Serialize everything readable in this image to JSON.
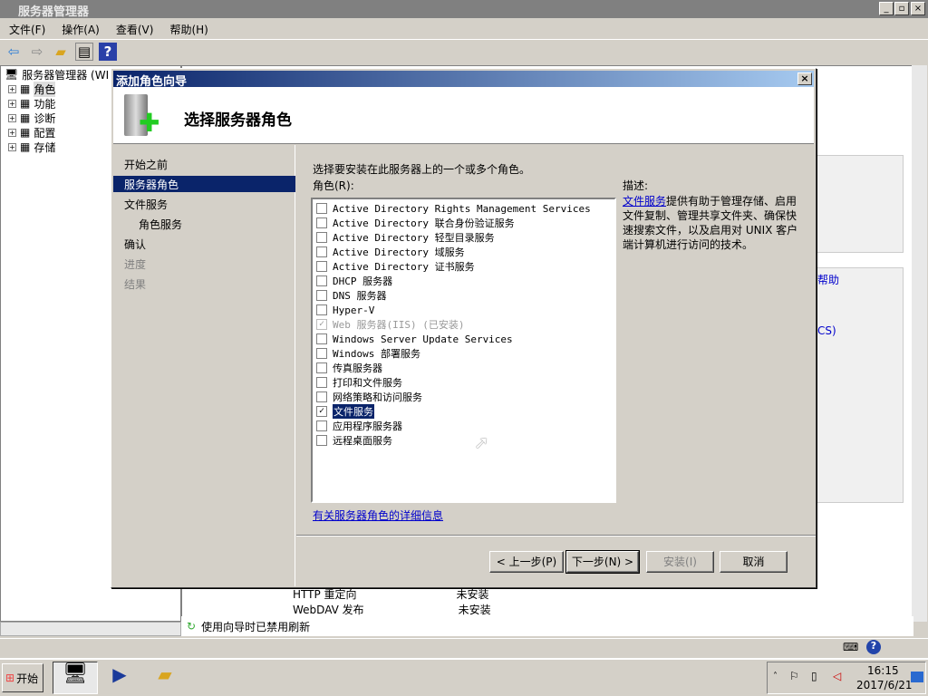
{
  "window": {
    "title": "服务器管理器",
    "min": "_",
    "restore": "▫",
    "close": "×"
  },
  "menu": [
    "文件(F)",
    "操作(A)",
    "查看(V)",
    "帮助(H)"
  ],
  "tree": {
    "root": "服务器管理器 (WI",
    "items": [
      "角色",
      "功能",
      "诊断",
      "配置",
      "存储"
    ]
  },
  "background": {
    "link_fragment": "帮助",
    "link_fragment2": "CS)",
    "rows": [
      {
        "name": "HTTP 重定向",
        "state": "未安装"
      },
      {
        "name": "WebDAV 发布",
        "state": "未安装"
      }
    ],
    "status": "使用向导时已禁用刷新"
  },
  "dialog": {
    "title": "添加角色向导",
    "heading": "选择服务器角色",
    "nav": [
      {
        "label": "开始之前",
        "state": "normal"
      },
      {
        "label": "服务器角色",
        "state": "selected"
      },
      {
        "label": "文件服务",
        "state": "normal"
      },
      {
        "label": "角色服务",
        "state": "sub"
      },
      {
        "label": "确认",
        "state": "normal"
      },
      {
        "label": "进度",
        "state": "disabled"
      },
      {
        "label": "结果",
        "state": "disabled"
      }
    ],
    "instruction": "选择要安装在此服务器上的一个或多个角色。",
    "roles_label": "角色(R):",
    "roles": [
      {
        "label": "Active Directory Rights Management Services",
        "checked": false
      },
      {
        "label": "Active Directory 联合身份验证服务",
        "checked": false
      },
      {
        "label": "Active Directory 轻型目录服务",
        "checked": false
      },
      {
        "label": "Active Directory 域服务",
        "checked": false
      },
      {
        "label": "Active Directory 证书服务",
        "checked": false
      },
      {
        "label": "DHCP 服务器",
        "checked": false
      },
      {
        "label": "DNS 服务器",
        "checked": false
      },
      {
        "label": "Hyper-V",
        "checked": false
      },
      {
        "label": "Web 服务器(IIS)  (已安装)",
        "checked": true,
        "disabled": true
      },
      {
        "label": "Windows Server Update Services",
        "checked": false
      },
      {
        "label": "Windows 部署服务",
        "checked": false
      },
      {
        "label": "传真服务器",
        "checked": false
      },
      {
        "label": "打印和文件服务",
        "checked": false
      },
      {
        "label": "网络策略和访问服务",
        "checked": false
      },
      {
        "label": "文件服务",
        "checked": true,
        "selected": true
      },
      {
        "label": "应用程序服务器",
        "checked": false
      },
      {
        "label": "远程桌面服务",
        "checked": false
      }
    ],
    "more_info_link": "有关服务器角色的详细信息",
    "desc_label": "描述:",
    "desc_link": "文件服务",
    "desc_text": "提供有助于管理存储、启用文件复制、管理共享文件夹、确保快速搜索文件，以及启用对 UNIX 客户端计算机进行访问的技术。",
    "buttons": {
      "back": "< 上一步(P)",
      "next": "下一步(N) >",
      "install": "安装(I)",
      "cancel": "取消"
    }
  },
  "taskbar": {
    "start": "开始",
    "time": "16:15",
    "date": "2017/6/21"
  }
}
